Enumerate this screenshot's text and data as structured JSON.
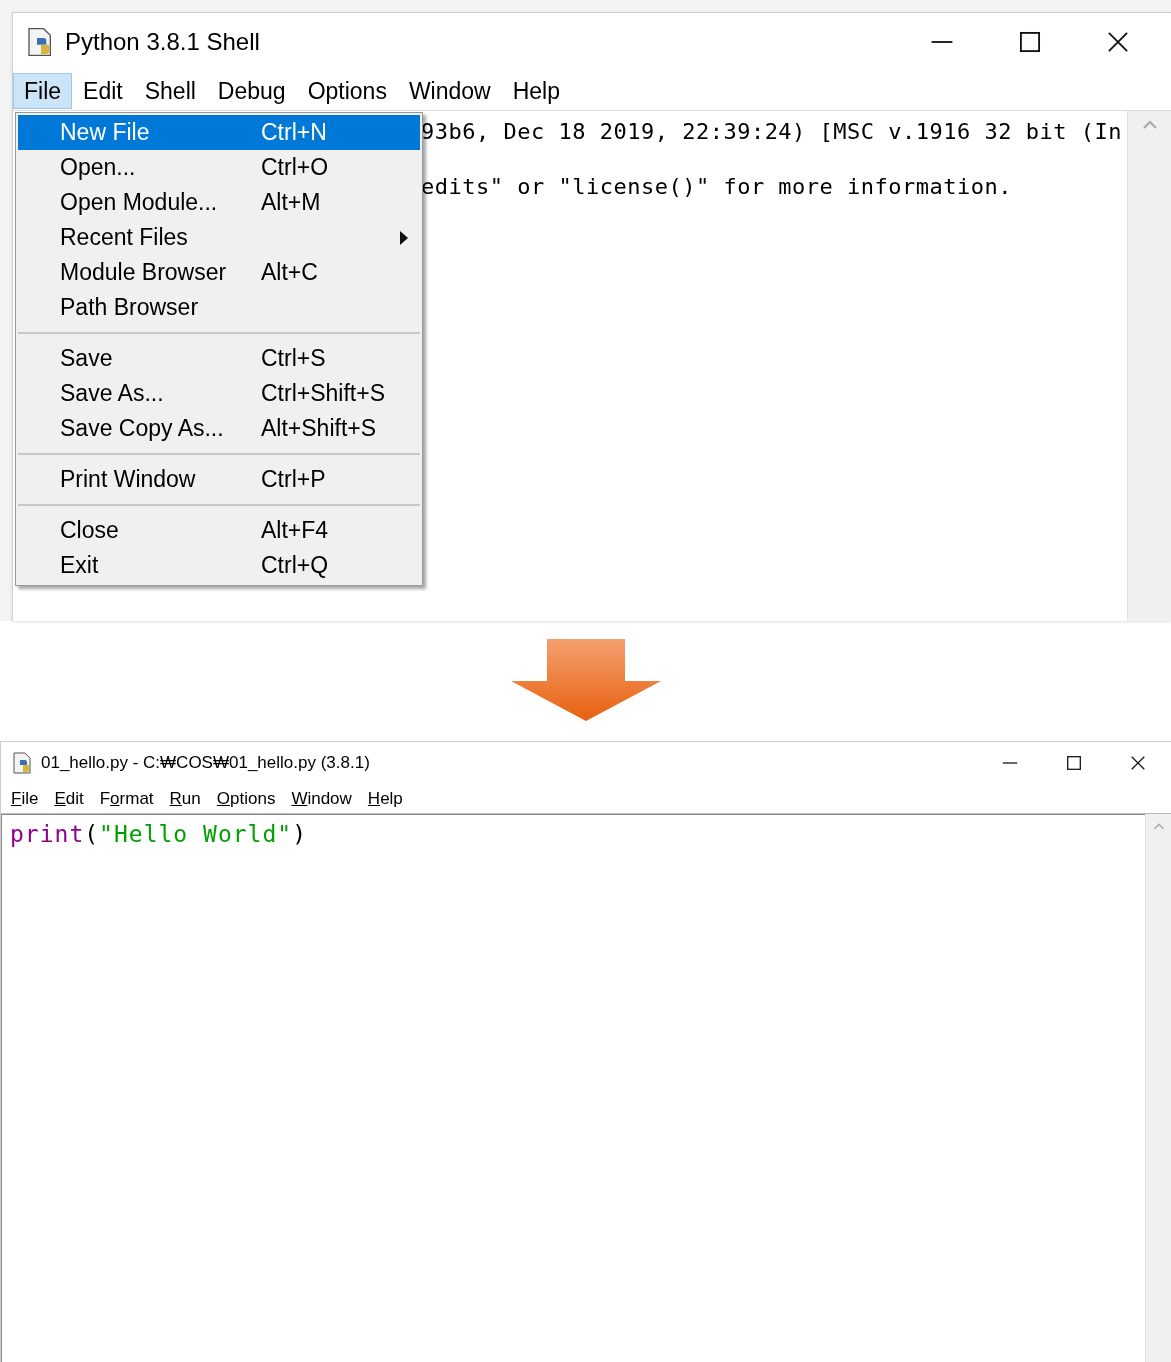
{
  "shell_window": {
    "title": "Python 3.8.1 Shell",
    "menu": [
      {
        "label": "File",
        "selected": true
      },
      {
        "label": "Edit",
        "selected": false
      },
      {
        "label": "Shell",
        "selected": false
      },
      {
        "label": "Debug",
        "selected": false
      },
      {
        "label": "Options",
        "selected": false
      },
      {
        "label": "Window",
        "selected": false
      },
      {
        "label": "Help",
        "selected": false
      }
    ],
    "text_lines": [
      "93b6, Dec 18 2019, 22:39:24) [MSC v.1916 32 bit (In",
      "edits\" or \"license()\" for more information."
    ],
    "file_menu": [
      {
        "kind": "item",
        "label": "New File",
        "shortcut": "Ctrl+N",
        "selected": true
      },
      {
        "kind": "item",
        "label": "Open...",
        "shortcut": "Ctrl+O",
        "selected": false
      },
      {
        "kind": "item",
        "label": "Open Module...",
        "shortcut": "Alt+M",
        "selected": false
      },
      {
        "kind": "submenu",
        "label": "Recent Files",
        "selected": false
      },
      {
        "kind": "item",
        "label": "Module Browser",
        "shortcut": "Alt+C",
        "selected": false
      },
      {
        "kind": "item",
        "label": "Path Browser",
        "selected": false
      },
      {
        "kind": "separator"
      },
      {
        "kind": "item",
        "label": "Save",
        "shortcut": "Ctrl+S",
        "selected": false
      },
      {
        "kind": "item",
        "label": "Save As...",
        "shortcut": "Ctrl+Shift+S",
        "selected": false
      },
      {
        "kind": "item",
        "label": "Save Copy As...",
        "shortcut": "Alt+Shift+S",
        "selected": false
      },
      {
        "kind": "separator"
      },
      {
        "kind": "item",
        "label": "Print Window",
        "shortcut": "Ctrl+P",
        "selected": false
      },
      {
        "kind": "separator"
      },
      {
        "kind": "item",
        "label": "Close",
        "shortcut": "Alt+F4",
        "selected": false
      },
      {
        "kind": "item",
        "label": "Exit",
        "shortcut": "Ctrl+Q",
        "selected": false
      }
    ]
  },
  "editor_window": {
    "title": "01_hello.py - C:₩COS₩01_hello.py (3.8.1)",
    "menu": [
      {
        "key": "F",
        "post": "ile"
      },
      {
        "key": "E",
        "post": "dit"
      },
      {
        "pre": "F",
        "key": "o",
        "post": "rmat"
      },
      {
        "key": "R",
        "post": "un"
      },
      {
        "key": "O",
        "post": "ptions"
      },
      {
        "key": "W",
        "post": "indow"
      },
      {
        "key": "H",
        "post": "elp"
      }
    ],
    "code": [
      {
        "kind": "builtin",
        "text": "print"
      },
      {
        "kind": "plain",
        "text": "("
      },
      {
        "kind": "string",
        "text": "\"Hello World\""
      },
      {
        "kind": "plain",
        "text": ")"
      }
    ]
  }
}
